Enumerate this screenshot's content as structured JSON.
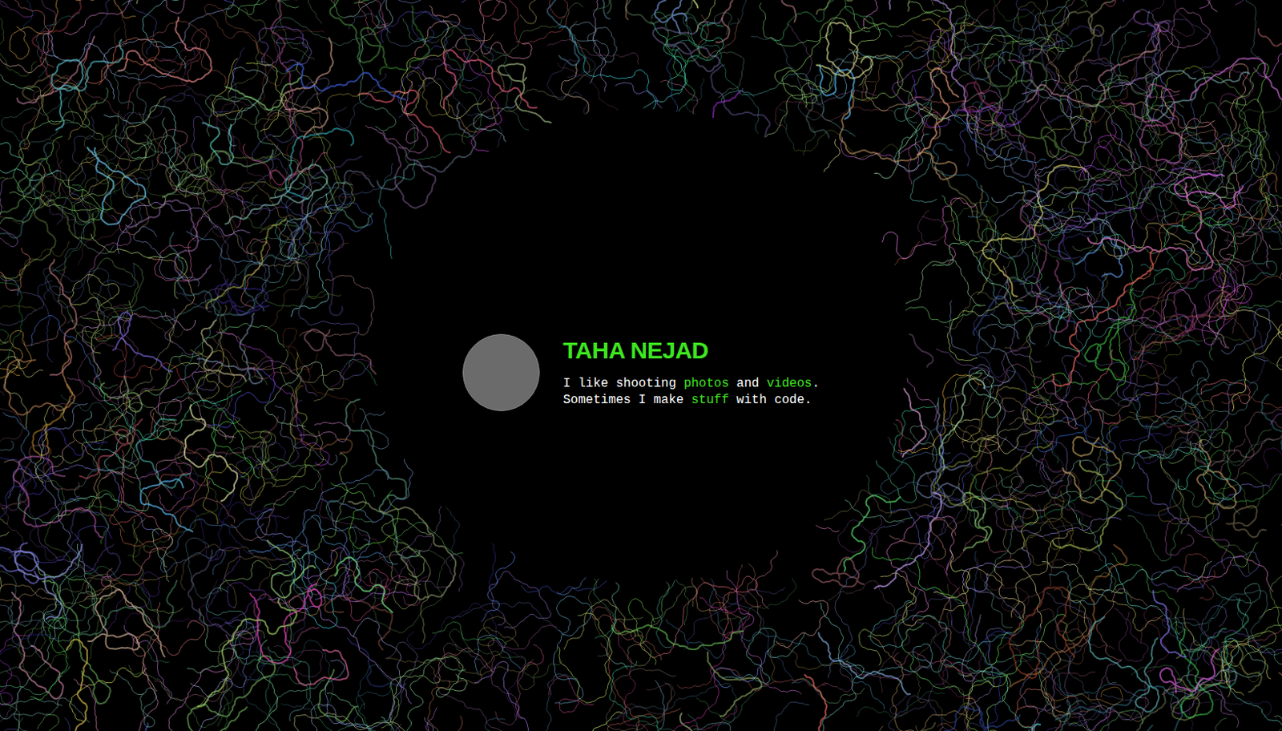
{
  "profile": {
    "name": "TAHA NEJAD",
    "avatar": {
      "kind": "photo"
    },
    "bio": [
      [
        {
          "text": "I like shooting ",
          "kind": "text"
        },
        {
          "text": "photos",
          "kind": "link"
        },
        {
          "text": " and ",
          "kind": "text"
        },
        {
          "text": "videos",
          "kind": "link"
        },
        {
          "text": ".",
          "kind": "text"
        }
      ],
      [
        {
          "text": "Sometimes I make ",
          "kind": "text"
        },
        {
          "text": "stuff",
          "kind": "link"
        },
        {
          "text": " with code.",
          "kind": "text"
        }
      ]
    ]
  }
}
